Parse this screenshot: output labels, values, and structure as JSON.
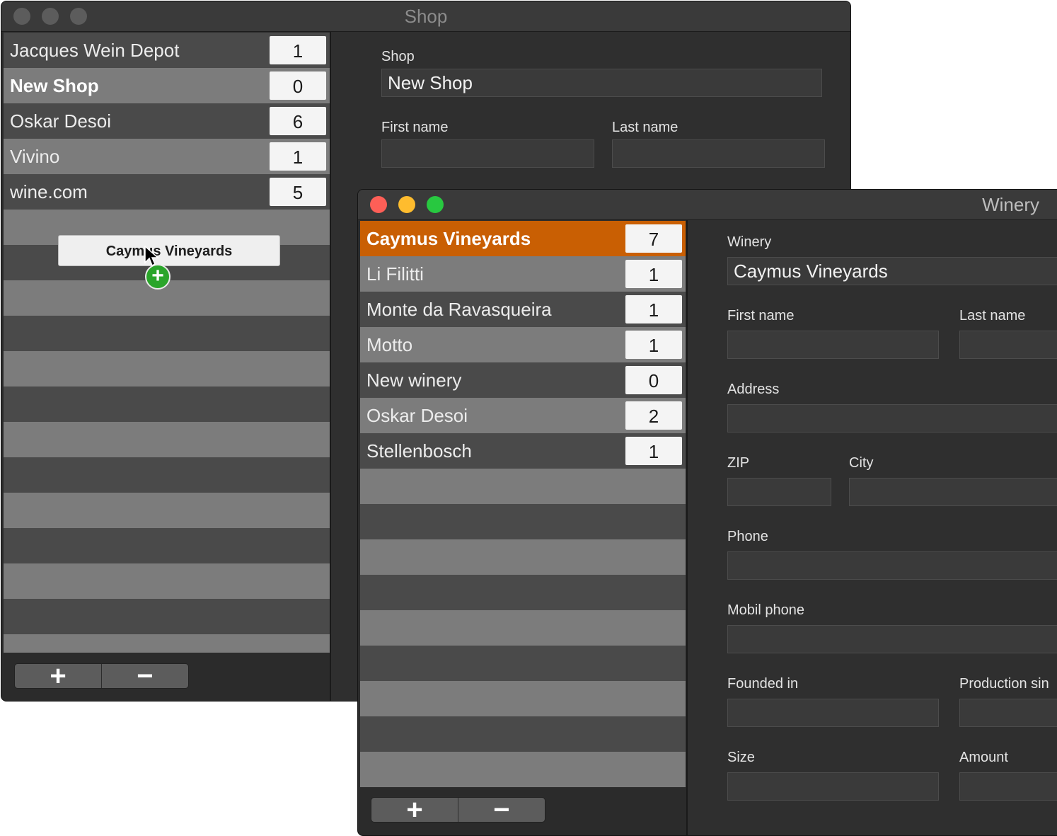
{
  "shop_window": {
    "title": "Shop",
    "items": [
      {
        "name": "Jacques Wein Depot",
        "count": "1"
      },
      {
        "name": "New Shop",
        "count": "0"
      },
      {
        "name": "Oskar Desoi",
        "count": "6"
      },
      {
        "name": "Vivino",
        "count": "1"
      },
      {
        "name": "wine.com",
        "count": "5"
      }
    ],
    "add_label": "+",
    "remove_label": "−",
    "form": {
      "shop_label": "Shop",
      "shop_value": "New Shop",
      "first_name_label": "First name",
      "first_name_value": "",
      "last_name_label": "Last name",
      "last_name_value": ""
    }
  },
  "drag_item": {
    "label": "Caymus Vineyards",
    "badge": "+"
  },
  "winery_window": {
    "title": "Winery",
    "items": [
      {
        "name": "Caymus Vineyards",
        "count": "7"
      },
      {
        "name": "Li Filitti",
        "count": "1"
      },
      {
        "name": "Monte da Ravasqueira",
        "count": "1"
      },
      {
        "name": "Motto",
        "count": "1"
      },
      {
        "name": "New winery",
        "count": "0"
      },
      {
        "name": "Oskar Desoi",
        "count": "2"
      },
      {
        "name": "Stellenbosch",
        "count": "1"
      }
    ],
    "add_label": "+",
    "remove_label": "−",
    "form": {
      "winery_label": "Winery",
      "winery_value": "Caymus Vineyards",
      "first_name_label": "First name",
      "last_name_label": "Last name",
      "address_label": "Address",
      "zip_label": "ZIP",
      "city_label": "City",
      "phone_label": "Phone",
      "mobil_phone_label": "Mobil phone",
      "founded_in_label": "Founded in",
      "production_since_label": "Production sin",
      "size_label": "Size",
      "amount_label": "Amount"
    }
  },
  "colors": {
    "selection": "#c95f03",
    "close": "#fe5f57",
    "minimize": "#febc2e",
    "zoom": "#28c840"
  }
}
